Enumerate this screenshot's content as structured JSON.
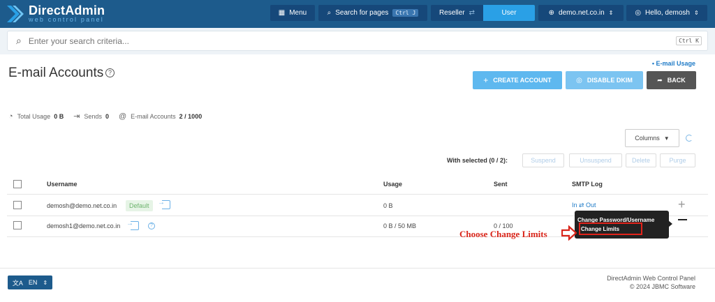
{
  "header": {
    "brand": "DirectAdmin",
    "tagline": "web control panel",
    "menu_label": "Menu",
    "search_pages_label": "Search for pages",
    "search_pages_shortcut": "Ctrl J",
    "role_reseller": "Reseller",
    "role_user": "User",
    "domain": "demo.net.co.in",
    "greeting": "Hello, demosh"
  },
  "search": {
    "placeholder": "Enter your search criteria...",
    "shortcut": "Ctrl K"
  },
  "page": {
    "title": "E-mail Accounts",
    "usage_link": "• E-mail Usage",
    "create_label": "CREATE ACCOUNT",
    "dkim_label": "DISABLE DKIM",
    "back_label": "BACK"
  },
  "stats": {
    "total_usage_label": "Total Usage",
    "total_usage_value": "0 B",
    "sends_label": "Sends",
    "sends_value": "0",
    "accounts_label": "E-mail Accounts",
    "accounts_value": "2 / 1000"
  },
  "table": {
    "columns_label": "Columns",
    "with_selected": "With selected (0 / 2):",
    "bulk_actions": [
      "Suspend",
      "Unsuspend",
      "Delete",
      "Purge"
    ],
    "headers": {
      "username": "Username",
      "usage": "Usage",
      "sent": "Sent",
      "smtp_log": "SMTP Log"
    },
    "rows": [
      {
        "username": "demosh@demo.net.co.in",
        "badge": "Default",
        "usage": "0 B",
        "sent": "",
        "smtp": "In ⇄ Out"
      },
      {
        "username": "demosh1@demo.net.co.in",
        "usage": "0 B / 50 MB",
        "sent": "0 / 100"
      }
    ]
  },
  "popup": {
    "items": [
      "Change Password/Username",
      "Change Limits"
    ]
  },
  "annotation": {
    "text": "Choose Change Limits"
  },
  "footer": {
    "lang": "EN",
    "line1": "DirectAdmin Web Control Panel",
    "line2": "© 2024 JBMC Software"
  },
  "colors": {
    "header_bg": "#1d5b8c",
    "accent_blue": "#2aa0e6",
    "create_btn": "#5eb8ef",
    "dkim_btn": "#7cc4f1",
    "back_btn": "#555555",
    "annotation_red": "#d9251a"
  }
}
